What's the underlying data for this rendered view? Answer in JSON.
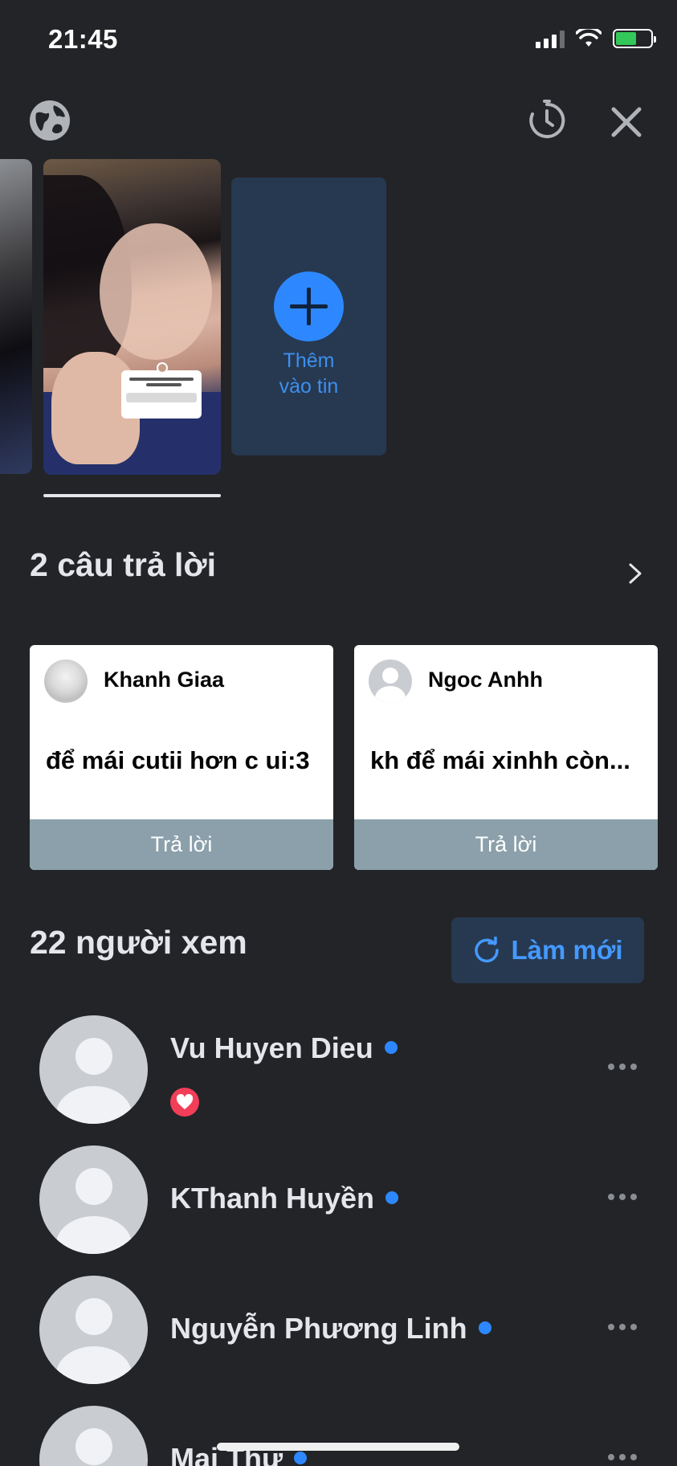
{
  "status_bar": {
    "time": "21:45"
  },
  "top_bar": {
    "globe_icon": "globe-icon",
    "timer_icon": "archive-timer-icon",
    "close_icon": "close-icon"
  },
  "story_strip": {
    "add_story_line1": "Thêm",
    "add_story_line2": "vào tin"
  },
  "replies": {
    "title": "2 câu trả lời",
    "items": [
      {
        "name": "Khanh Giaa",
        "message": "để mái cutii hơn c ui:3",
        "button": "Trả lời"
      },
      {
        "name": "Ngoc Anhh",
        "message": "kh để mái xinhh còn...",
        "button": "Trả lời"
      }
    ]
  },
  "viewers": {
    "title": "22 người xem",
    "refresh_label": "Làm mới",
    "items": [
      {
        "name": "Vu Huyen Dieu",
        "reaction": "heart"
      },
      {
        "name": "KThanh Huyền"
      },
      {
        "name": "Nguyễn Phương Linh"
      },
      {
        "name": "Mai Thư"
      }
    ]
  },
  "colors": {
    "background": "#232427",
    "accent": "#2d88ff",
    "reply_button": "#8ba0aa",
    "refresh_bg": "#263951"
  }
}
